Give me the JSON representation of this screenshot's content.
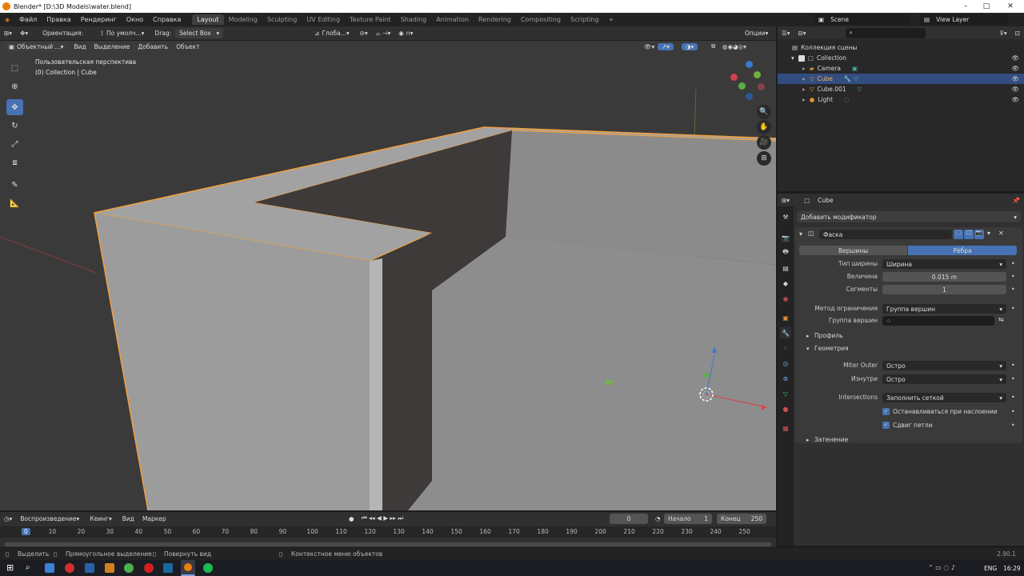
{
  "window": {
    "title": "Blender* [D:\\3D Models\\water.blend]"
  },
  "menu": [
    "Файл",
    "Правка",
    "Рендеринг",
    "Окно",
    "Справка"
  ],
  "workspaces": [
    "Layout",
    "Modeling",
    "Sculpting",
    "UV Editing",
    "Texture Paint",
    "Shading",
    "Animation",
    "Rendering",
    "Compositing",
    "Scripting"
  ],
  "topbar": {
    "scene": "Scene",
    "view_layer": "View Layer"
  },
  "tool_header": {
    "orientation_label": "Ориентация:",
    "orientation_value": "По умолч...",
    "drag_label": "Drag:",
    "drag_value": "Select Box",
    "transform_space": "Глоба...",
    "options": "Опции"
  },
  "viewport_header": {
    "mode": "Объектный ...",
    "view": "Вид",
    "select": "Выделение",
    "add": "Добавить",
    "object": "Объект"
  },
  "viewport": {
    "perspective": "Пользовательская перспектива",
    "collection": "(0) Collection | Cube",
    "gizmo_labels": [
      "X",
      "Y",
      "Z"
    ]
  },
  "outliner": {
    "search_placeholder": "",
    "scene_collection": "Коллекция сцены",
    "items": [
      {
        "name": "Collection"
      },
      {
        "name": "Camera"
      },
      {
        "name": "Cube"
      },
      {
        "name": "Cube.001"
      },
      {
        "name": "Light"
      }
    ]
  },
  "properties": {
    "object_name": "Cube",
    "add_modifier": "Добавить модификатор",
    "modifier_name": "Фаска",
    "affect": [
      "Вершины",
      "Рёбра"
    ],
    "width_type_label": "Тип ширины",
    "width_type_value": "Ширина",
    "amount_label": "Величина",
    "amount_value": "0.015 m",
    "segments_label": "Сегменты",
    "segments_value": "1",
    "limit_method_label": "Метод ограничения",
    "limit_method_value": "Группа вершин",
    "vertex_group_label": "Группа вершин",
    "profile": "Профиль",
    "geometry": "Геометрия",
    "miter_outer_label": "Miter Outer",
    "miter_outer_value": "Остро",
    "inner_label": "Изнутри",
    "inner_value": "Остро",
    "intersections_label": "Intersections",
    "intersections_value": "Заполнить сеткой",
    "clamp_overlap": "Останавливаться при наслоении",
    "loop_slide": "Сдвиг петли",
    "shading": "Затенение"
  },
  "timeline": {
    "playback": "Воспроизведение",
    "keying": "Кеинг",
    "view": "Вид",
    "marker": "Маркер",
    "current_frame": "0",
    "start_label": "Начало",
    "start_value": "1",
    "end_label": "Конец",
    "end_value": "250",
    "ruler": [
      "0",
      "10",
      "20",
      "30",
      "40",
      "50",
      "60",
      "70",
      "80",
      "90",
      "100",
      "110",
      "120",
      "130",
      "140",
      "150",
      "160",
      "170",
      "180",
      "190",
      "200",
      "210",
      "220",
      "230",
      "240",
      "250"
    ]
  },
  "statusbar": {
    "select": "Выделить",
    "box_select": "Прямоугольное выделение",
    "rotate_view": "Повернуть вид",
    "context_menu": "Контекстное меню объектов",
    "version": "2.90.1"
  },
  "taskbar": {
    "lang": "ENG",
    "time": "16:29"
  },
  "colors": {
    "accent": "#4772b3",
    "selection_outline": "#f0a040",
    "viewport_bg": "#3a3a3a"
  }
}
